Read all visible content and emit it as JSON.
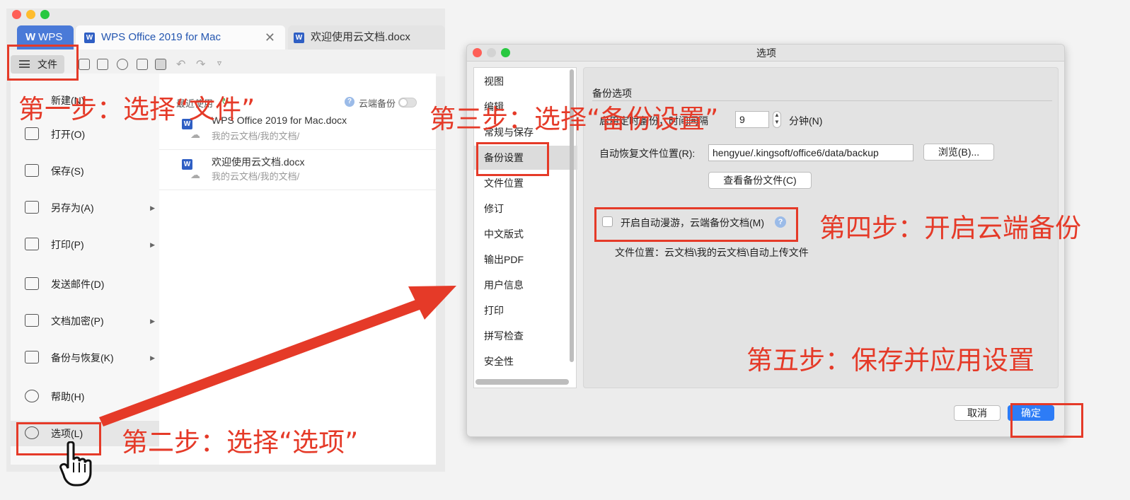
{
  "wps": {
    "tabs": [
      {
        "label": "WPS"
      },
      {
        "label": "WPS Office 2019 for Mac"
      },
      {
        "label": "欢迎使用云文档.docx"
      }
    ],
    "file_button": "文件",
    "menu": {
      "items": [
        {
          "label": "新建(N)"
        },
        {
          "label": "打开(O)"
        },
        {
          "label": "保存(S)"
        },
        {
          "label": "另存为(A)"
        },
        {
          "label": "打印(P)"
        },
        {
          "label": "发送邮件(D)"
        },
        {
          "label": "文档加密(P)"
        },
        {
          "label": "备份与恢复(K)"
        },
        {
          "label": "帮助(H)"
        },
        {
          "label": "选项(L)"
        }
      ]
    },
    "recent": {
      "title": "最近使用",
      "cloud_backup_label": "云端备份",
      "files": [
        {
          "name": "WPS Office 2019 for Mac.docx",
          "path": "我的云文档/我的文档/"
        },
        {
          "name": "欢迎使用云文档.docx",
          "path": "我的云文档/我的文档/"
        }
      ]
    }
  },
  "dialog": {
    "title": "选项",
    "nav": [
      {
        "label": "视图"
      },
      {
        "label": "编辑"
      },
      {
        "label": "常规与保存"
      },
      {
        "label": "备份设置"
      },
      {
        "label": "文件位置"
      },
      {
        "label": "修订"
      },
      {
        "label": "中文版式"
      },
      {
        "label": "输出PDF"
      },
      {
        "label": "用户信息"
      },
      {
        "label": "打印"
      },
      {
        "label": "拼写检查"
      },
      {
        "label": "安全性"
      }
    ],
    "selected_nav": "备份设置",
    "section_title": "备份选项",
    "backup_interval_label": "启用定时备份，时间间隔",
    "backup_interval_value": "9",
    "minutes_label": "分钟(N)",
    "recover_location_label": "自动恢复文件位置(R):",
    "recover_location_value": "hengyue/.kingsoft/office6/data/backup",
    "browse_button": "浏览(B)...",
    "view_backup_button": "查看备份文件(C)",
    "cloud_roam_checkbox_label": "开启自动漫游，云端备份文档(M)",
    "cloud_roam_checked": false,
    "file_location_text": "文件位置：云文档\\我的云文档\\自动上传文件",
    "cancel_button": "取消",
    "ok_button": "确定"
  },
  "annotations": {
    "step1": "第一步：选择“文件”",
    "step2": "第二步：选择“选项”",
    "step3": "第三步：选择“备份设置”",
    "step4": "第四步：开启云端备份",
    "step5": "第五步：保存并应用设置",
    "color": "#e53a28"
  },
  "colors": {
    "wps_tab": "#4a7ad8",
    "primary_button": "#2d7cf6"
  }
}
